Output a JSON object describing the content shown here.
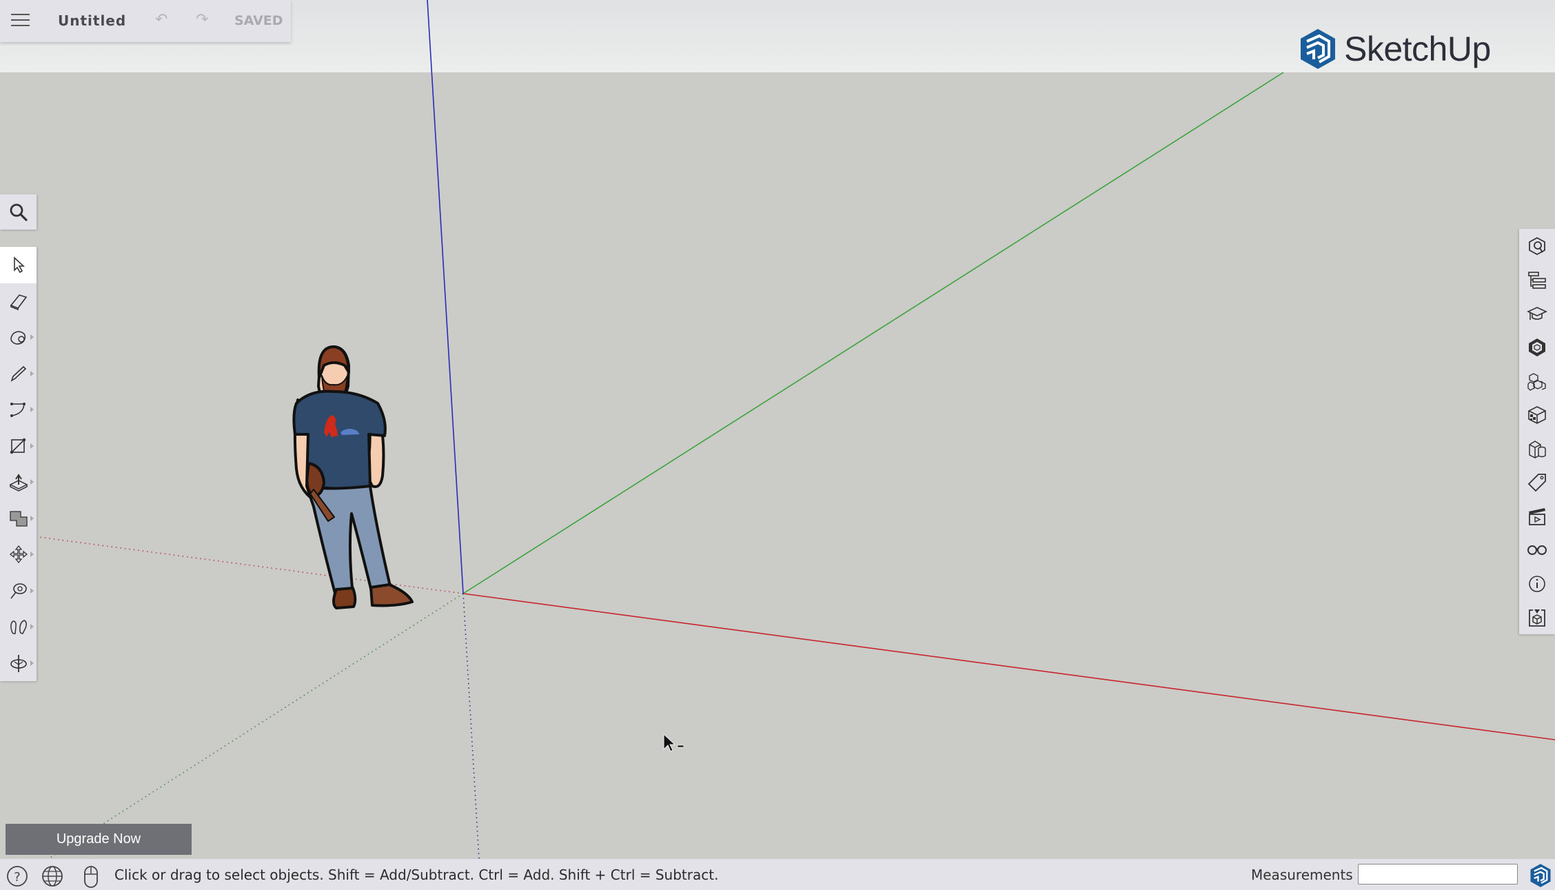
{
  "app": {
    "name": "SketchUp",
    "brand_color": "#1b5e9c"
  },
  "file_panel": {
    "menu_icon": "hamburger-menu-icon",
    "title": "Untitled",
    "undo_icon": "undo-icon",
    "redo_icon": "redo-icon",
    "save_status": "SAVED"
  },
  "search": {
    "icon": "search-icon"
  },
  "left_toolbar": {
    "tools": [
      {
        "name": "Select",
        "icon": "select-arrow-icon",
        "active": true,
        "flyout": false
      },
      {
        "name": "Eraser",
        "icon": "eraser-icon",
        "active": false,
        "flyout": false
      },
      {
        "name": "Paint Bucket",
        "icon": "paint-icon",
        "active": false,
        "flyout": true
      },
      {
        "name": "Line",
        "icon": "pencil-icon",
        "active": false,
        "flyout": true
      },
      {
        "name": "Arc",
        "icon": "arc-icon",
        "active": false,
        "flyout": true
      },
      {
        "name": "Rectangle",
        "icon": "rectangle-icon",
        "active": false,
        "flyout": true
      },
      {
        "name": "Push/Pull",
        "icon": "push-pull-icon",
        "active": false,
        "flyout": true
      },
      {
        "name": "Offset",
        "icon": "offset-icon",
        "active": false,
        "flyout": true
      },
      {
        "name": "Move",
        "icon": "move-icon",
        "active": false,
        "flyout": true
      },
      {
        "name": "Tape Measure",
        "icon": "tape-measure-icon",
        "active": false,
        "flyout": true
      },
      {
        "name": "Walk",
        "icon": "footprints-icon",
        "active": false,
        "flyout": true
      },
      {
        "name": "Orbit",
        "icon": "orbit-icon",
        "active": false,
        "flyout": true
      }
    ]
  },
  "right_toolbar": {
    "panels": [
      {
        "name": "Entity Info",
        "icon": "entity-info-icon"
      },
      {
        "name": "Outliner",
        "icon": "outliner-icon"
      },
      {
        "name": "Instructor",
        "icon": "instructor-icon"
      },
      {
        "name": "Styles",
        "icon": "styles-icon"
      },
      {
        "name": "Components",
        "icon": "components-icon"
      },
      {
        "name": "Materials",
        "icon": "materials-icon"
      },
      {
        "name": "Solid Tools",
        "icon": "solid-tools-icon"
      },
      {
        "name": "Tags",
        "icon": "tag-icon"
      },
      {
        "name": "Scenes",
        "icon": "scenes-icon"
      },
      {
        "name": "Display",
        "icon": "glasses-icon"
      },
      {
        "name": "Model Info",
        "icon": "info-icon"
      },
      {
        "name": "3D Warehouse",
        "icon": "warehouse-icon"
      }
    ]
  },
  "viewport": {
    "axis_colors": {
      "red": "#c8252b",
      "green": "#3ba33b",
      "blue": "#2a2ab8"
    },
    "sky_colors": [
      "#dfe1e3",
      "#eceeed"
    ],
    "ground_color": "#cbcbc8"
  },
  "upgrade_button": {
    "label": "Upgrade Now"
  },
  "status_bar": {
    "help_icon": "help-icon",
    "geo_icon": "globe-icon",
    "mouse_icon": "mouse-icon",
    "message": "Click or drag to select objects. Shift = Add/Subtract. Ctrl = Add. Shift + Ctrl = Subtract.",
    "measurements_label": "Measurements",
    "measurements_value": "",
    "logo_icon": "sketchup-logo-icon"
  }
}
